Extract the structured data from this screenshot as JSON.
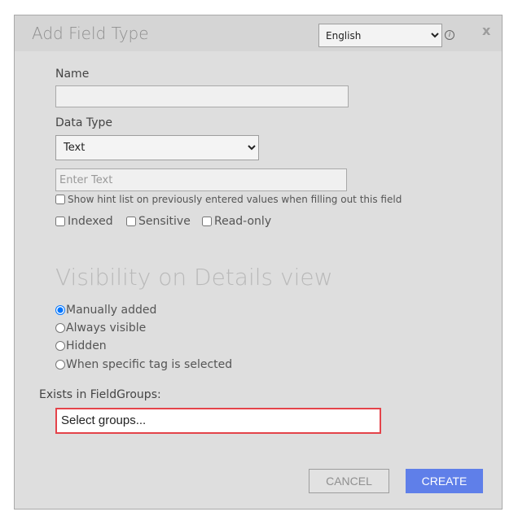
{
  "dialog": {
    "title": "Add Field Type",
    "language": {
      "selected": "English"
    },
    "close_label": "x"
  },
  "form": {
    "name_label": "Name",
    "name_value": "",
    "data_type_label": "Data Type",
    "data_type_selected": "Text",
    "hint_placeholder": "Enter Text",
    "show_hint_label": "Show hint list on previously entered values when filling out this field",
    "indexed_label": "Indexed",
    "sensitive_label": "Sensitive",
    "readonly_label": "Read-only"
  },
  "visibility": {
    "title": "Visibility on Details view",
    "options": [
      {
        "label": "Manually added",
        "checked": true
      },
      {
        "label": "Always visible",
        "checked": false
      },
      {
        "label": "Hidden",
        "checked": false
      },
      {
        "label": "When specific tag is selected",
        "checked": false
      }
    ]
  },
  "groups": {
    "label": "Exists in FieldGroups:",
    "placeholder": "Select groups..."
  },
  "buttons": {
    "cancel": "CANCEL",
    "create": "CREATE"
  },
  "colors": {
    "create_button": "#5f7fe9",
    "groups_border": "#e4434a",
    "dialog_bg": "#dedede"
  }
}
